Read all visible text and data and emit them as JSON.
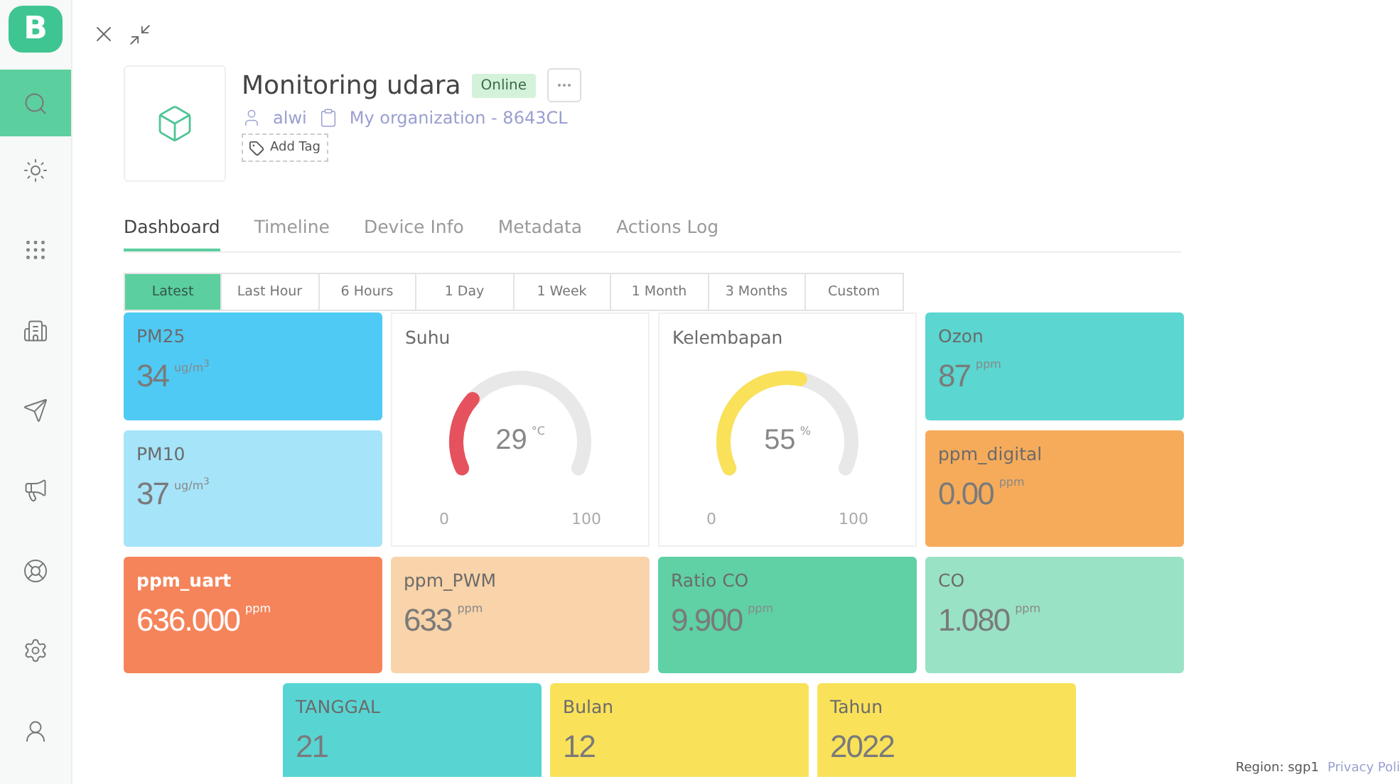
{
  "sidebar": {
    "logo": "B",
    "items": [
      {
        "kind": "search",
        "selected": true
      },
      {
        "kind": "sun",
        "selected": false
      },
      {
        "kind": "grid",
        "selected": false
      },
      {
        "kind": "building",
        "selected": false
      },
      {
        "kind": "send",
        "selected": false
      },
      {
        "kind": "megaphone",
        "selected": false
      },
      {
        "kind": "lifebuoy",
        "selected": false
      },
      {
        "kind": "settings",
        "selected": false
      },
      {
        "kind": "user",
        "selected": false
      }
    ]
  },
  "device": {
    "title": "Monitoring udara",
    "status": "Online",
    "owner": "alwi",
    "organization": "My organization - 8643CL",
    "add_tag": "Add Tag"
  },
  "tabs": [
    {
      "label": "Dashboard",
      "selected": true
    },
    {
      "label": "Timeline",
      "selected": false
    },
    {
      "label": "Device Info",
      "selected": false
    },
    {
      "label": "Metadata",
      "selected": false
    },
    {
      "label": "Actions Log",
      "selected": false
    }
  ],
  "time_ranges": [
    {
      "label": "Latest",
      "selected": true
    },
    {
      "label": "Last Hour",
      "selected": false
    },
    {
      "label": "6 Hours",
      "selected": false
    },
    {
      "label": "1 Day",
      "selected": false
    },
    {
      "label": "1 Week",
      "selected": false
    },
    {
      "label": "1 Month",
      "selected": false
    },
    {
      "label": "3 Months",
      "selected": false
    },
    {
      "label": "Custom",
      "selected": false
    }
  ],
  "widgets": [
    {
      "kind": "value",
      "title": "PM25",
      "value": "34",
      "unit": "ug/m$^{3}$",
      "color": "#4fcaf5",
      "highlighted": false
    },
    {
      "kind": "gauge",
      "title": "Suhu",
      "value": "29",
      "unit": "°C",
      "min": "0",
      "max": "100",
      "color": "#e5525d"
    },
    {
      "kind": "gauge",
      "title": "Kelembapan",
      "value": "55",
      "unit": "%",
      "min": "0",
      "max": "100",
      "color": "#f9e15a"
    },
    {
      "kind": "value",
      "title": "Ozon",
      "value": "87",
      "unit": "ppm",
      "color": "#5bd6d0",
      "highlighted": false
    },
    {
      "kind": "value",
      "title": "PM10",
      "value": "37",
      "unit": "ug/m$^{3}$",
      "color": "#a6e4fa",
      "highlighted": false
    },
    {
      "kind": "value",
      "title": "ppm_digital",
      "value": "0.00",
      "unit": "ppm",
      "color": "#f6ab5b",
      "highlighted": false
    },
    {
      "kind": "value",
      "title": "ppm_uart",
      "value": "636.000",
      "unit": "ppm",
      "color": "#f5845a",
      "highlighted": true
    },
    {
      "kind": "value",
      "title": "ppm_PWM",
      "value": "633",
      "unit": "ppm",
      "color": "#f9d3a9",
      "highlighted": false
    },
    {
      "kind": "value",
      "title": "Ratio CO",
      "value": "9.900",
      "unit": "ppm",
      "color": "#5fd1a5",
      "highlighted": false
    },
    {
      "kind": "value",
      "title": "CO",
      "value": "1.080",
      "unit": "ppm",
      "color": "#9ae2c5",
      "highlighted": false
    }
  ],
  "bottom_widgets": [
    {
      "kind": "value",
      "title": "TANGGAL",
      "value": "21",
      "color": "#58d5d3",
      "highlighted": false
    },
    {
      "kind": "value",
      "title": "Bulan",
      "value": "12",
      "color": "#f9e15a",
      "highlighted": false
    },
    {
      "kind": "value",
      "title": "Tahun",
      "value": "2022",
      "color": "#f9e15a",
      "highlighted": false
    }
  ],
  "footer": {
    "region": "Region: sgp1",
    "privacy": "Privacy Poli"
  }
}
